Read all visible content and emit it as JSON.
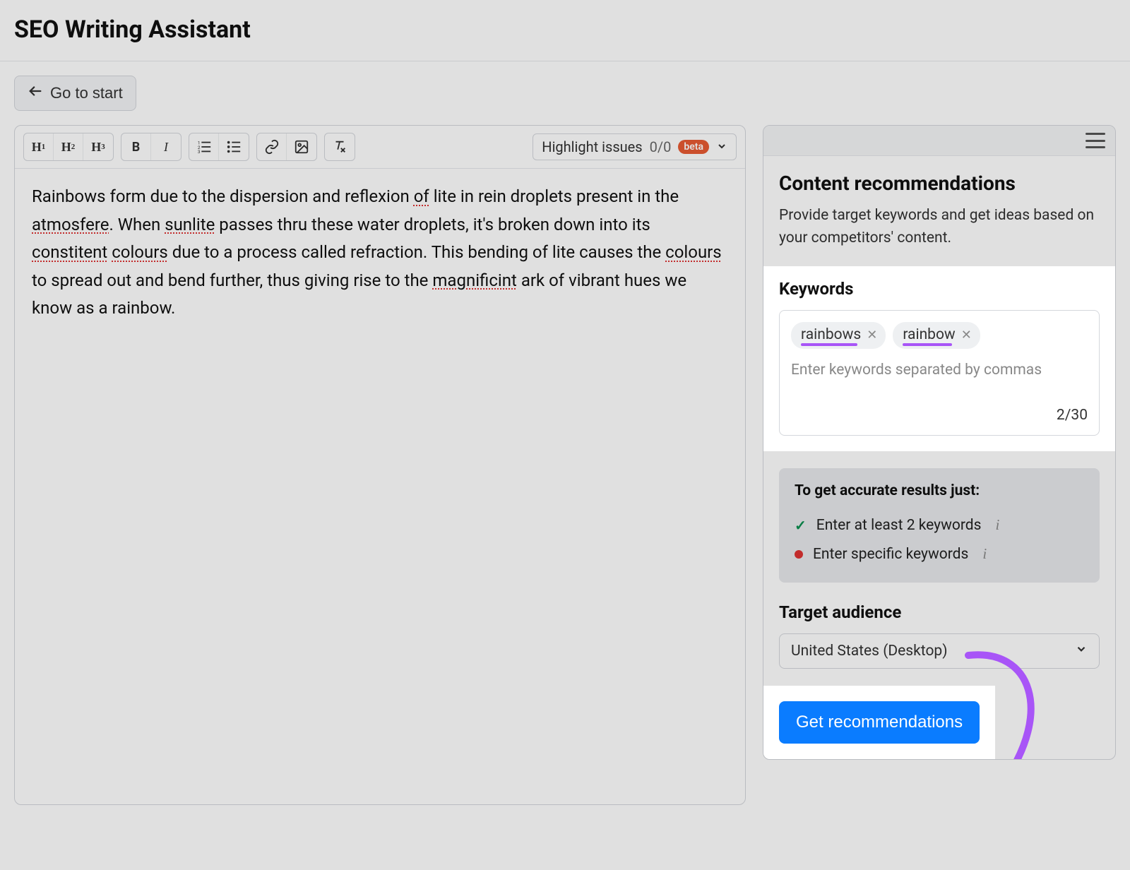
{
  "header": {
    "title": "SEO Writing Assistant"
  },
  "go_start": "Go to start",
  "toolbar": {
    "h1": "H",
    "h1sub": "1",
    "h2": "H",
    "h2sub": "2",
    "h3": "H",
    "h3sub": "3",
    "bold": "B",
    "italic": "I",
    "highlight_label": "Highlight issues",
    "highlight_count": "0/0",
    "beta": "beta"
  },
  "editor": {
    "segments": [
      {
        "t": "Rainbows form due to the dispersion and reflexion "
      },
      {
        "t": "of",
        "err": true
      },
      {
        "t": " lite in rein droplets present in the "
      },
      {
        "t": "atmosfere",
        "err": true
      },
      {
        "t": ". When "
      },
      {
        "t": "sunlite",
        "err": true
      },
      {
        "t": " passes thru these water droplets, it's broken down into its "
      },
      {
        "t": "constitent",
        "err": true
      },
      {
        "t": " "
      },
      {
        "t": "colours",
        "err": true
      },
      {
        "t": " due to a process called refraction. This bending of lite causes the "
      },
      {
        "t": "colours",
        "err": true
      },
      {
        "t": " to spread out and bend further, thus giving rise to the "
      },
      {
        "t": "magnificint",
        "err": true
      },
      {
        "t": " ark of vibrant hues we know as a rainbow."
      }
    ]
  },
  "panel": {
    "title": "Content recommendations",
    "subtitle": "Provide target keywords and get ideas based on your competitors' content.",
    "keywords_label": "Keywords",
    "chips": [
      "rainbows",
      "rainbow"
    ],
    "kw_placeholder": "Enter keywords separated by commas",
    "kw_count": "2/30",
    "tips_title": "To get accurate results just:",
    "tip1": "Enter at least 2 keywords",
    "tip2": "Enter specific keywords",
    "target_label": "Target audience",
    "target_value": "United States (Desktop)",
    "cta": "Get recommendations"
  }
}
